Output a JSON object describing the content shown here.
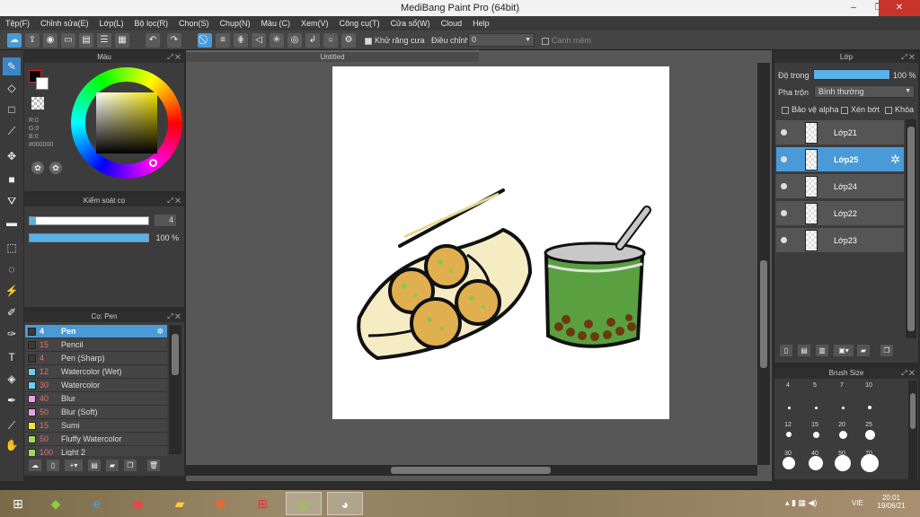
{
  "window": {
    "title": "MediBang Paint Pro (64bit)",
    "minimize": "–",
    "maximize": "❐",
    "close": "✕"
  },
  "menu": [
    "Tệp(F)",
    "Chỉnh sửa(E)",
    "Lớp(L)",
    "Bộ lọc(R)",
    "Chọn(S)",
    "Chụp(N)",
    "Màu (C)",
    "Xem(V)",
    "Công cụ(T)",
    "Cửa sổ(W)",
    "Cloud",
    "Help"
  ],
  "toolbar": {
    "antialias_label": "Khử răng cưa",
    "correction_label": "Điều chỉnh",
    "correction_value": "0",
    "edge_label": "Canh mềm"
  },
  "color_panel": {
    "title": "Màu",
    "r": "R:0",
    "g": "G:0",
    "b": "B:0",
    "hex": "#000000"
  },
  "brush_control": {
    "title": "Kiểm soát cọ",
    "size_value": "4",
    "opacity_value": "100 %",
    "size_fraction": 0.05,
    "opacity_fraction": 1.0
  },
  "brush_panel": {
    "title": "Cọ: Pen",
    "brushes": [
      {
        "size": "4",
        "name": "Pen",
        "color": "#3a3a3a"
      },
      {
        "size": "15",
        "name": "Pencil",
        "color": "#3a3a3a"
      },
      {
        "size": "4",
        "name": "Pen (Sharp)",
        "color": "#3a3a3a"
      },
      {
        "size": "12",
        "name": "Watercolor (Wet)",
        "color": "#6ad0f0"
      },
      {
        "size": "30",
        "name": "Watercolor",
        "color": "#6ad0f0"
      },
      {
        "size": "40",
        "name": "Blur",
        "color": "#e8a0e8"
      },
      {
        "size": "50",
        "name": "Blur (Soft)",
        "color": "#e8a0e8"
      },
      {
        "size": "15",
        "name": "Sumi",
        "color": "#f0e040"
      },
      {
        "size": "50",
        "name": "Fluffy Watercolor",
        "color": "#a0d860"
      },
      {
        "size": "100",
        "name": "Light 2",
        "color": "#a0d860"
      }
    ]
  },
  "canvas": {
    "tab_title": "Untitled"
  },
  "layer_panel": {
    "title": "Lớp",
    "opacity_label": "Độ trong",
    "opacity_value": "100 %",
    "blend_label": "Pha trộn",
    "blend_value": "Bình thường",
    "protect_alpha": "Bảo vệ alpha",
    "clipping": "Xén bớt",
    "lock": "Khóa",
    "layers": [
      {
        "name": "Lớp21",
        "selected": false
      },
      {
        "name": "Lớp25",
        "selected": true
      },
      {
        "name": "Lớp24",
        "selected": false
      },
      {
        "name": "Lớp22",
        "selected": false
      },
      {
        "name": "Lớp23",
        "selected": false
      }
    ]
  },
  "brush_size_panel": {
    "title": "Brush Size",
    "sizes": [
      "4",
      "5",
      "7",
      "10",
      "12",
      "15",
      "20",
      "25",
      "30",
      "40",
      "50",
      "70"
    ]
  },
  "taskbar": {
    "lang": "VIE",
    "time": "20:01",
    "date": "19/06/21"
  }
}
